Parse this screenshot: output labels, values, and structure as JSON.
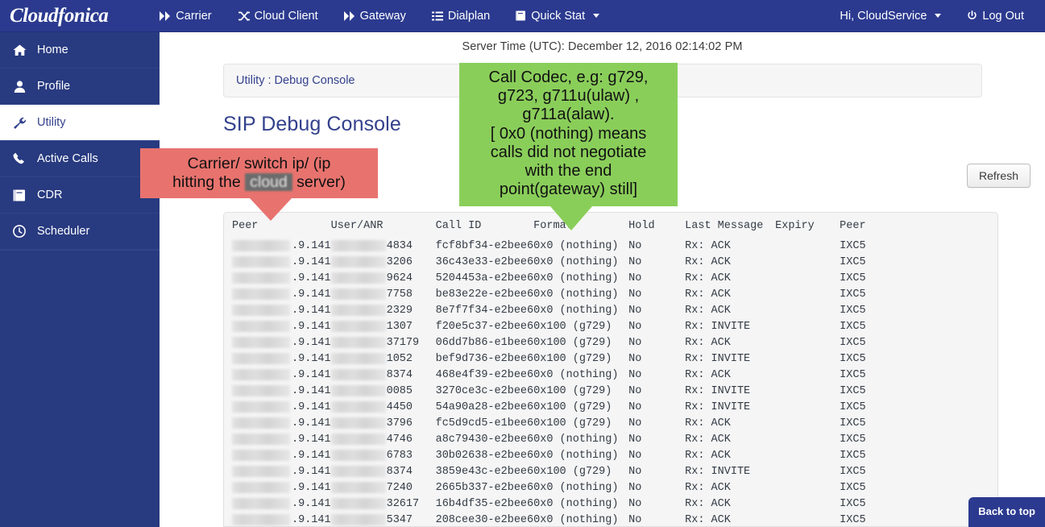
{
  "brand": "Cloudfonica",
  "navbar": {
    "items": [
      {
        "label": "Carrier",
        "icon": "fast-forward-icon"
      },
      {
        "label": "Cloud Client",
        "icon": "shuffle-icon"
      },
      {
        "label": "Gateway",
        "icon": "fast-forward-icon"
      },
      {
        "label": "Dialplan",
        "icon": "list-icon"
      },
      {
        "label": "Quick Stat",
        "icon": "book-icon",
        "caret": true
      }
    ],
    "user_label": "Hi, CloudService",
    "logout_label": "Log Out"
  },
  "sidebar": {
    "items": [
      {
        "label": "Home",
        "icon": "home-icon",
        "active": false
      },
      {
        "label": "Profile",
        "icon": "user-icon",
        "active": false
      },
      {
        "label": "Utility",
        "icon": "wrench-icon",
        "active": true
      },
      {
        "label": "Active Calls",
        "icon": "phone-icon",
        "active": false
      },
      {
        "label": "CDR",
        "icon": "book-icon",
        "active": false
      },
      {
        "label": "Scheduler",
        "icon": "clock-icon",
        "active": false
      }
    ]
  },
  "main": {
    "server_time": "Server Time (UTC): December 12, 2016 02:14:02 PM",
    "breadcrumb": "Utility : Debug Console",
    "page_title": "SIP Debug Console",
    "refresh_label": "Refresh",
    "back_to_top_label": "Back to top"
  },
  "annotations": {
    "carrier": {
      "line1": "Carrier/ switch ip/ (ip",
      "line2_pre": "hitting the ",
      "line2_redacted": "cloud",
      "line2_post": " server)",
      "color": "#e8736e"
    },
    "codec": {
      "text": "Call Codec, e.g: g729, g723, g711u(ulaw) , g711a(alaw).\n[ 0x0 (nothing) means calls did not negotiate with the end point(gateway) still]",
      "lines": [
        "Call Codec, e.g: g729,",
        "g723, g711u(ulaw) ,",
        "g711a(alaw).",
        "[ 0x0 (nothing) means",
        "calls did not negotiate",
        "with the end",
        "point(gateway) still]"
      ],
      "color": "#8ace5a"
    }
  },
  "console": {
    "headers": [
      "Peer",
      "User/ANR",
      "Call ID",
      "Format",
      "Hold",
      "Last Message",
      "Expiry",
      "Peer"
    ],
    "rows": [
      {
        "peer_suffix": ".9.141",
        "user": "4834",
        "call_id": "fcf8bf34-e2bee6",
        "format": "0x0 (nothing)",
        "hold": "No",
        "last_message": "Rx: ACK",
        "expiry": "",
        "peer2": "IXC5"
      },
      {
        "peer_suffix": ".9.141",
        "user": "3206",
        "call_id": "36c43e33-e2bee6",
        "format": "0x0 (nothing)",
        "hold": "No",
        "last_message": "Rx: ACK",
        "expiry": "",
        "peer2": "IXC5"
      },
      {
        "peer_suffix": ".9.141",
        "user": "9624",
        "call_id": "5204453a-e2bee6",
        "format": "0x0 (nothing)",
        "hold": "No",
        "last_message": "Rx: ACK",
        "expiry": "",
        "peer2": "IXC5"
      },
      {
        "peer_suffix": ".9.141",
        "user": "7758",
        "call_id": "be83e22e-e2bee6",
        "format": "0x0 (nothing)",
        "hold": "No",
        "last_message": "Rx: ACK",
        "expiry": "",
        "peer2": "IXC5"
      },
      {
        "peer_suffix": ".9.141",
        "user": "2329",
        "call_id": "8e7f7f34-e2bee6",
        "format": "0x0 (nothing)",
        "hold": "No",
        "last_message": "Rx: ACK",
        "expiry": "",
        "peer2": "IXC5"
      },
      {
        "peer_suffix": ".9.141",
        "user": "1307",
        "call_id": "f20e5c37-e2bee6",
        "format": "0x100 (g729)",
        "hold": "No",
        "last_message": "Rx: INVITE",
        "expiry": "",
        "peer2": "IXC5"
      },
      {
        "peer_suffix": ".9.141",
        "user": "37179",
        "call_id": "06dd7b86-e1bee6",
        "format": "0x100 (g729)",
        "hold": "No",
        "last_message": "Rx: ACK",
        "expiry": "",
        "peer2": "IXC5"
      },
      {
        "peer_suffix": ".9.141",
        "user": "1052",
        "call_id": "bef9d736-e2bee6",
        "format": "0x100 (g729)",
        "hold": "No",
        "last_message": "Rx: INVITE",
        "expiry": "",
        "peer2": "IXC5"
      },
      {
        "peer_suffix": ".9.141",
        "user": "8374",
        "call_id": "468e4f39-e2bee6",
        "format": "0x0 (nothing)",
        "hold": "No",
        "last_message": "Rx: ACK",
        "expiry": "",
        "peer2": "IXC5"
      },
      {
        "peer_suffix": ".9.141",
        "user": "0085",
        "call_id": "3270ce3c-e2bee6",
        "format": "0x100 (g729)",
        "hold": "No",
        "last_message": "Rx: INVITE",
        "expiry": "",
        "peer2": "IXC5"
      },
      {
        "peer_suffix": ".9.141",
        "user": "4450",
        "call_id": "54a90a28-e2bee6",
        "format": "0x100 (g729)",
        "hold": "No",
        "last_message": "Rx: INVITE",
        "expiry": "",
        "peer2": "IXC5"
      },
      {
        "peer_suffix": ".9.141",
        "user": "3796",
        "call_id": "fc5d9cd5-e1bee6",
        "format": "0x100 (g729)",
        "hold": "No",
        "last_message": "Rx: ACK",
        "expiry": "",
        "peer2": "IXC5"
      },
      {
        "peer_suffix": ".9.141",
        "user": "4746",
        "call_id": "a8c79430-e2bee6",
        "format": "0x0 (nothing)",
        "hold": "No",
        "last_message": "Rx: ACK",
        "expiry": "",
        "peer2": "IXC5"
      },
      {
        "peer_suffix": ".9.141",
        "user": "6783",
        "call_id": "30b02638-e2bee6",
        "format": "0x0 (nothing)",
        "hold": "No",
        "last_message": "Rx: ACK",
        "expiry": "",
        "peer2": "IXC5"
      },
      {
        "peer_suffix": ".9.141",
        "user": "8374",
        "call_id": "3859e43c-e2bee6",
        "format": "0x100 (g729)",
        "hold": "No",
        "last_message": "Rx: INVITE",
        "expiry": "",
        "peer2": "IXC5"
      },
      {
        "peer_suffix": ".9.141",
        "user": "7240",
        "call_id": "2665b337-e2bee6",
        "format": "0x0 (nothing)",
        "hold": "No",
        "last_message": "Rx: ACK",
        "expiry": "",
        "peer2": "IXC5"
      },
      {
        "peer_suffix": ".9.141",
        "user": "32617",
        "call_id": "16b4df35-e2bee6",
        "format": "0x0 (nothing)",
        "hold": "No",
        "last_message": "Rx: ACK",
        "expiry": "",
        "peer2": "IXC5"
      },
      {
        "peer_suffix": ".9.141",
        "user": "5347",
        "call_id": "208cee30-e2bee6",
        "format": "0x0 (nothing)",
        "hold": "No",
        "last_message": "Rx: ACK",
        "expiry": "",
        "peer2": "IXC5"
      }
    ]
  },
  "colors": {
    "navy": "#2b3a8f",
    "sidebar": "#283a80",
    "link": "#33418c",
    "callout_red": "#e8736e",
    "callout_green": "#8ace5a"
  }
}
